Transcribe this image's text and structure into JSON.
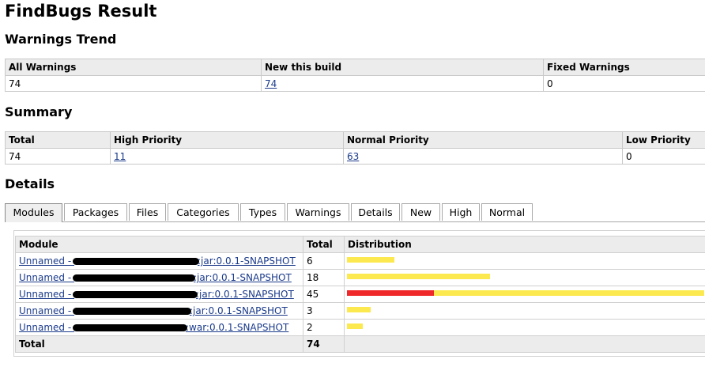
{
  "title": "FindBugs Result",
  "trend": {
    "heading": "Warnings Trend",
    "headers": [
      "All Warnings",
      "New this build",
      "Fixed Warnings"
    ],
    "values": [
      "74",
      "74",
      "0"
    ]
  },
  "summary": {
    "heading": "Summary",
    "headers": [
      "Total",
      "High Priority",
      "Normal Priority",
      "Low Priority"
    ],
    "values": [
      "74",
      "11",
      "63",
      "0"
    ]
  },
  "details": {
    "heading": "Details",
    "tabs": [
      "Modules",
      "Packages",
      "Files",
      "Categories",
      "Types",
      "Warnings",
      "Details",
      "New",
      "High",
      "Normal"
    ],
    "active_tab": "Modules"
  },
  "modules": {
    "headers": [
      "Module",
      "Total",
      "Distribution"
    ],
    "rows": [
      {
        "prefix": "Unnamed - ",
        "suffix": ":jar:0.0.1-SNAPSHOT",
        "total": "6",
        "high": 0,
        "normal": 6
      },
      {
        "prefix": "Unnamed - ",
        "suffix": ":jar:0.0.1-SNAPSHOT",
        "total": "18",
        "high": 0,
        "normal": 18
      },
      {
        "prefix": "Unnamed - ",
        "suffix": ":jar:0.0.1-SNAPSHOT",
        "total": "45",
        "high": 11,
        "normal": 34
      },
      {
        "prefix": "Unnamed - ",
        "suffix": ":jar:0.0.1-SNAPSHOT",
        "total": "3",
        "high": 0,
        "normal": 3
      },
      {
        "prefix": "Unnamed - ",
        "suffix": ":war:0.0.1-SNAPSHOT",
        "total": "2",
        "high": 0,
        "normal": 2
      }
    ],
    "footer_label": "Total",
    "footer_total": "74"
  },
  "colors": {
    "high": "#ef2929",
    "normal": "#fce94f",
    "link": "#1a3a8a"
  }
}
